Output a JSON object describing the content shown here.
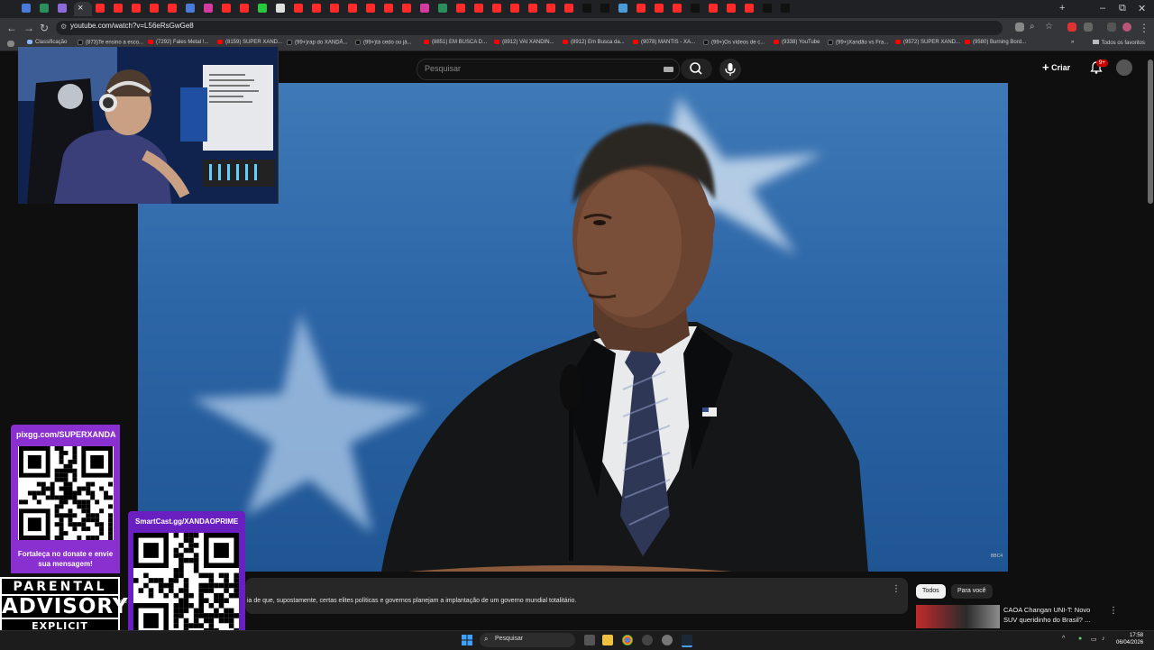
{
  "browser": {
    "active_tab_close": "×",
    "new_tab": "+",
    "window_controls": {
      "minimize": "–",
      "maximize": "⧉",
      "close": "✕"
    },
    "url": "youtube.com/watch?v=L56eRsGwGe8",
    "bookmarks": [
      {
        "label": "Classificação",
        "icon": "globe"
      },
      {
        "label": "(873)Te ensino a esco...",
        "icon": "tiktok"
      },
      {
        "label": "(7292) Fales Metal !...",
        "icon": "youtube"
      },
      {
        "label": "(8159) SUPER XAND...",
        "icon": "youtube"
      },
      {
        "label": "(99+)rap do XANDÃ...",
        "icon": "tiktok"
      },
      {
        "label": "(99+)tá cedo ou já...",
        "icon": "tiktok"
      },
      {
        "label": "(8851) EM BUSCA D...",
        "icon": "youtube"
      },
      {
        "label": "(8912) VAI XANDIN...",
        "icon": "youtube"
      },
      {
        "label": "(8912) Em Busca da...",
        "icon": "youtube"
      },
      {
        "label": "(9078) MANTIS - XA...",
        "icon": "youtube"
      },
      {
        "label": "(99+)Os vídeos de c...",
        "icon": "tiktok"
      },
      {
        "label": "(9338) YouTube",
        "icon": "youtube"
      },
      {
        "label": "(99+)Xandão vs Fra...",
        "icon": "tiktok"
      },
      {
        "label": "(9572) SUPER XAND...",
        "icon": "youtube"
      },
      {
        "label": "(9580) Burning Bord...",
        "icon": "youtube"
      }
    ],
    "bookmarks_more": "»",
    "all_bookmarks": "Todos os favoritos"
  },
  "youtube": {
    "search_placeholder": "Pesquisar",
    "create_label": "Criar",
    "notifications_badge": "9+",
    "description_text": "ia de que, supostamente, certas elites políticas e governos planejam a implantação de um governo mundial totalitário.",
    "description_prefix": "ou",
    "chips": [
      "Todos",
      "Para você"
    ],
    "recommended": {
      "title": "CAOA Changan UNI-T: Novo SUV queridinho do Brasil? ..."
    },
    "video_watermark": "BBC4"
  },
  "overlay": {
    "pix_url": "pixgg.com/SUPERXANDA",
    "pix_caption": "Fortaleça no donate e envie sua mensagem!",
    "smartcast_url": "SmartCast.gg/XANDAOPRIME",
    "advisory": [
      "PARENTAL",
      "ADVISORY",
      "EXPLICIT CONTENT"
    ]
  },
  "taskbar": {
    "search_label": "Pesquisar",
    "time": "17:58",
    "date": "06/04/2026"
  },
  "colors": {
    "youtube_bg": "#0f0f0f",
    "youtube_red": "#ff0000",
    "overlay_purple": "#8a2fd0",
    "video_sky_blue": "#2d66a7"
  }
}
